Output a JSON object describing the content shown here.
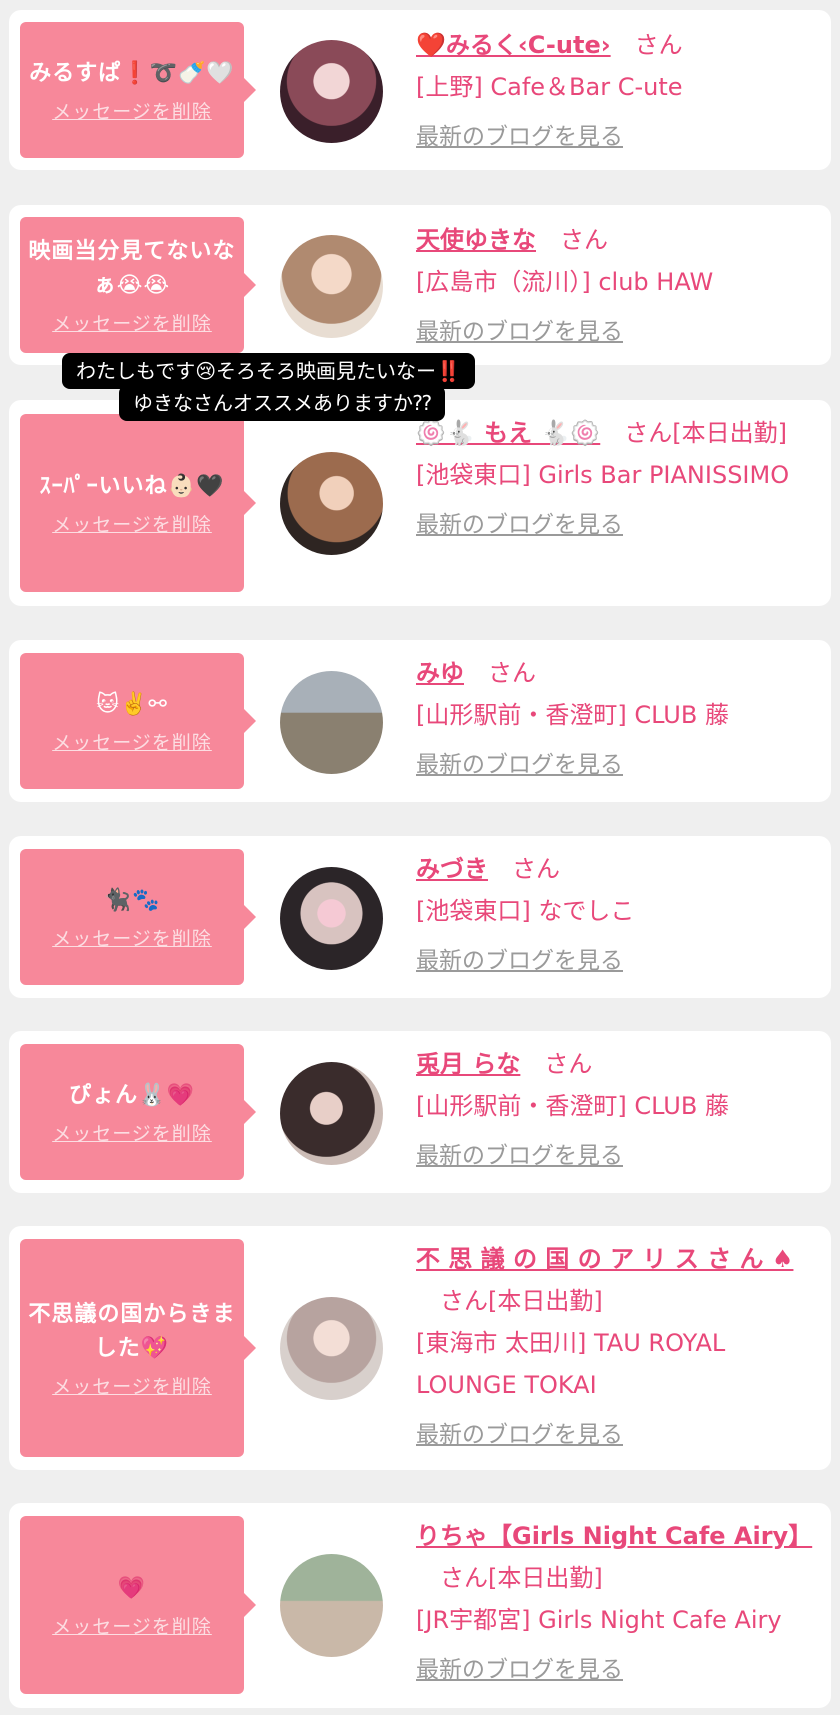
{
  "entries": [
    {
      "message": "みるすぱ❗➰🍼🤍",
      "delete_label": "メッセージを削除",
      "name": "❤️みるく‹C-ute›",
      "san": "さん",
      "shop": "[上野] Cafe＆Bar C-ute",
      "blog_label": "最新のブログを見る"
    },
    {
      "message": "映画当分見てないなぁ😭😭",
      "delete_label": "メッセージを削除",
      "name": "天使ゆきな",
      "san": "さん",
      "shop": "[広島市（流川）] club HAW",
      "blog_label": "最新のブログを見る"
    },
    {
      "message": "ｽｰﾊﾟｰいいね👶🏻🖤",
      "delete_label": "メッセージを削除",
      "name": "🍥🐇 もえ 🐇🍥",
      "san": "さん[本日出勤]",
      "shop": "[池袋東口] Girls Bar PIANISSIMO",
      "blog_label": "最新のブログを見る"
    },
    {
      "message": "🐱✌️⚯",
      "delete_label": "メッセージを削除",
      "name": "みゆ",
      "san": "さん",
      "shop": "[山形駅前・香澄町] CLUB 藤",
      "blog_label": "最新のブログを見る"
    },
    {
      "message": "🐈‍⬛🐾",
      "delete_label": "メッセージを削除",
      "name": "みづき",
      "san": "さん",
      "shop": "[池袋東口] なでしこ",
      "blog_label": "最新のブログを見る"
    },
    {
      "message": "ぴょん🐰💗",
      "delete_label": "メッセージを削除",
      "name": "兎月 らな",
      "san": "さん",
      "shop": "[山形駅前・香澄町] CLUB 藤",
      "blog_label": "最新のブログを見る"
    },
    {
      "message": "不思議の国からきました💖",
      "delete_label": "メッセージを削除",
      "name": "不 思 議 の 国 の ア リ ス さ ん ♠",
      "san": "さん[本日出勤]",
      "shop": "[東海市 太田川] TAU ROYAL LOUNGE TOKAI",
      "blog_label": "最新のブログを見る"
    },
    {
      "message": "💗",
      "delete_label": "メッセージを削除",
      "name": "りちゃ【Girls Night Cafe Airy】",
      "san": "さん[本日出勤]",
      "shop": "[JR宇都宮] Girls Night Cafe Airy",
      "blog_label": "最新のブログを見る"
    }
  ],
  "reply_tooltip": {
    "line1": "わたしもです😢そろそろ映画見たいなー‼️",
    "line2": "ゆきなさんオススメありますか⁇"
  },
  "avatars": [
    "#6b3a4a",
    "#c9a38f",
    "#7a4f3a",
    "#b8a99a",
    "#3b3338",
    "#4a3a38",
    "#8b8586",
    "#8f9e8c"
  ]
}
